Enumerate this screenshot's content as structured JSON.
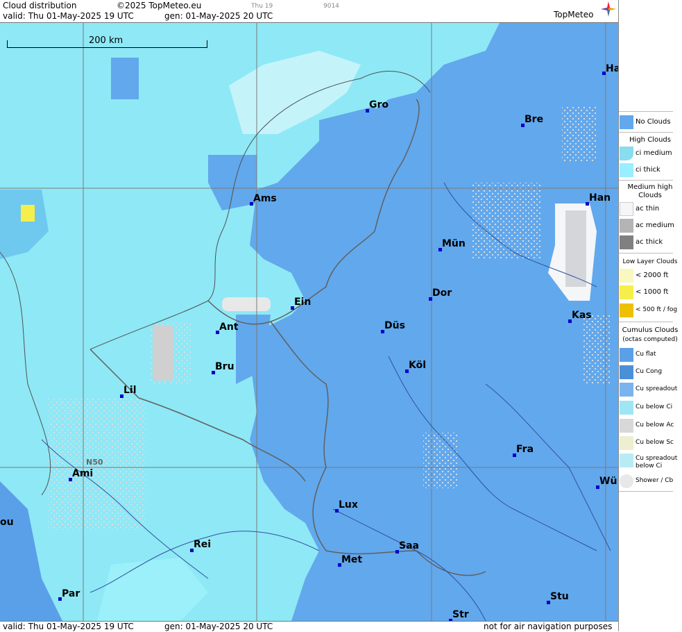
{
  "header": {
    "title": "Cloud distribution",
    "copyright": "©2025 TopMeteo.eu",
    "small_time": "Thu 19",
    "small_code": "9014",
    "valid": "valid:  Thu  01-May-2025  19 UTC",
    "gen": "gen: 01-May-2025 20 UTC",
    "brand": "TopMeteo"
  },
  "footer": {
    "valid": "valid:  Thu  01-May-2025  19 UTC",
    "gen": "gen: 01-May-2025 20 UTC",
    "disclaimer": "not for air navigation purposes"
  },
  "map": {
    "scale_label": "200 km",
    "parallel_label": "N50",
    "cities": [
      "Ha",
      "Gro",
      "Bre",
      "Ams",
      "Han",
      "Mün",
      "Dor",
      "Ein",
      "Kas",
      "Ant",
      "Düs",
      "Bru",
      "Köl",
      "Lil",
      "Fra",
      "Ami",
      "Wü",
      "Lux",
      "ou",
      "Rei",
      "Saa",
      "Met",
      "Par",
      "Stu",
      "Str"
    ],
    "colors": {
      "no_clouds": "#66aaee",
      "ci_medium": "#88ddee",
      "ci_thick": "#99eeff",
      "cu_flat": "#5aa0e8",
      "land_clear": "#62a8ec",
      "speckle": "#d8d8d8"
    }
  },
  "legend": {
    "no_clouds": "No Clouds",
    "high_clouds": "High Clouds",
    "ci_medium": "ci medium",
    "ci_thick": "ci thick",
    "medium_high_1": "Medium high",
    "medium_high_2": "Clouds",
    "ac_thin": "ac thin",
    "ac_medium": "ac medium",
    "ac_thick": "ac thick",
    "low_layer": "Low Layer Clouds",
    "lt2000": "< 2000 ft",
    "lt1000": "< 1000 ft",
    "lt500": "< 500 ft / fog",
    "cumulus_1": "Cumulus Clouds",
    "cumulus_2": "(octas computed)",
    "cu_flat": "Cu flat",
    "cu_cong": "Cu Cong",
    "cu_spreadout": "Cu spreadout",
    "cu_below_ci": "Cu below Ci",
    "cu_below_ac": "Cu below Ac",
    "cu_below_sc": "Cu below Sc",
    "cu_spread_below_ci_1": "Cu spreadout",
    "cu_spread_below_ci_2": "below Ci",
    "shower": "Shower / Cb"
  }
}
